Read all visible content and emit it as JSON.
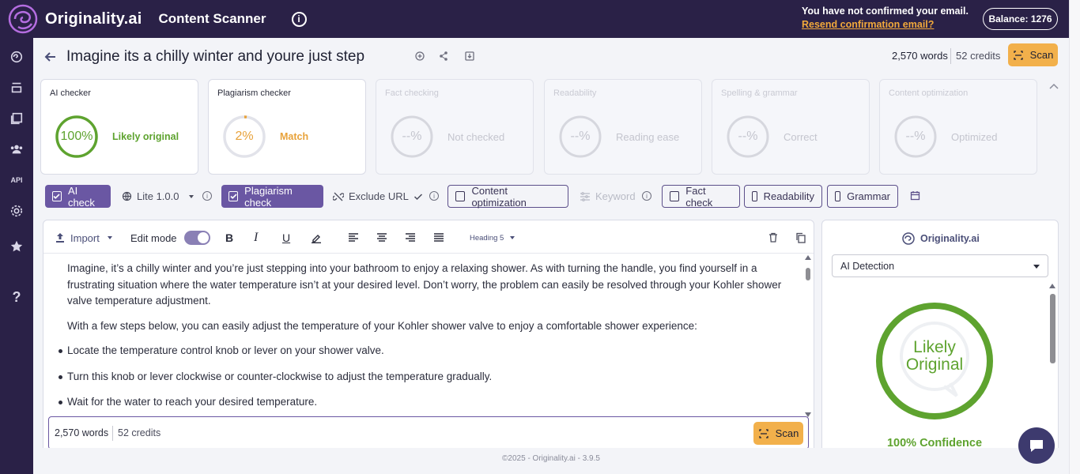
{
  "header": {
    "brand": "Originality.ai",
    "app_title": "Content Scanner",
    "email_notice": "You have not confirmed your email.",
    "resend_link": "Resend confirmation email?",
    "balance": "Balance: 1276"
  },
  "document": {
    "title": "Imagine its a chilly winter and youre just step",
    "words": "2,570 words",
    "credits": "52 credits",
    "scan_label": "Scan"
  },
  "cards": [
    {
      "title": "AI checker",
      "value": "100%",
      "status": "Likely original",
      "color": "#5ea32f",
      "percent": 100
    },
    {
      "title": "Plagiarism checker",
      "value": "2%",
      "status": "Match",
      "color": "#e8a23a",
      "percent": 2
    },
    {
      "title": "Fact checking",
      "value": "--%",
      "status": "Not checked"
    },
    {
      "title": "Readability",
      "value": "--%",
      "status": "Reading ease"
    },
    {
      "title": "Spelling & grammar",
      "value": "--%",
      "status": "Correct"
    },
    {
      "title": "Content optimization",
      "value": "--%",
      "status": "Optimized"
    }
  ],
  "toolbar": {
    "ai_check": "AI check",
    "model": "Lite 1.0.0",
    "plagiarism_check": "Plagiarism check",
    "exclude_url": "Exclude URL",
    "content_optimization": "Content optimization",
    "keyword": "Keyword",
    "fact_check": "Fact check",
    "readability": "Readability",
    "grammar": "Grammar"
  },
  "editor": {
    "import": "Import",
    "edit_mode": "Edit mode",
    "heading_select": "Heading 5",
    "paragraphs": [
      "Imagine, it’s a chilly winter and you’re just stepping into your bathroom to enjoy a relaxing shower. As with turning the handle, you find yourself in a frustrating situation where the water temperature isn’t at your desired level. Don’t worry, the problem can easily be resolved through your Kohler shower valve temperature adjustment.",
      "With a few steps below, you can easily adjust the temperature of your Kohler shower valve to enjoy a comfortable shower experience:"
    ],
    "bullets": [
      "Locate the temperature control knob or lever on your shower valve.",
      "Turn this knob or lever clockwise or counter-clockwise to adjust the temperature gradually.",
      "Wait for the water to reach your desired temperature."
    ],
    "footer_words": "2,570 words",
    "footer_credits": "52 credits",
    "footer_scan": "Scan"
  },
  "right_panel": {
    "brand": "Originality.ai",
    "select_value": "AI Detection",
    "result_line1": "Likely",
    "result_line2": "Original",
    "confidence": "100% Confidence",
    "accent_color": "#5ea32f"
  },
  "footer": {
    "text": "©2025 - Originality.ai - 3.9.5"
  }
}
